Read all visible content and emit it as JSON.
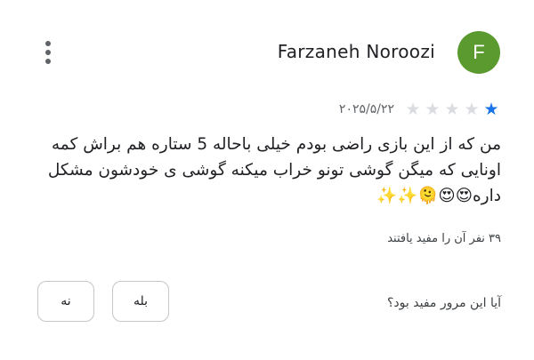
{
  "review": {
    "author": "Farzaneh Noroozi",
    "avatar_letter": "F",
    "avatar_color": "#5a9a2f",
    "rating": 1,
    "max_rating": 5,
    "date": "۲۰۲۵/۵/۲۲",
    "text": "من که از این بازی راضی بودم خیلی باحاله 5 ستاره هم براش کمه اونایی که میگن گوشی تونو خراب میکنه گوشی ی خودشون مشکل داره😍😍🫠✨✨",
    "helpful_count_text": "۳۹ نفر آن را مفید یافتند",
    "helpful_question": "آیا این مرور مفید بود؟",
    "yes_label": "بله",
    "no_label": "نه",
    "icons": {
      "menu": "more-vert-icon",
      "star": "star-icon"
    },
    "colors": {
      "star_filled": "#1a73e8",
      "star_empty": "#dadce0"
    }
  }
}
